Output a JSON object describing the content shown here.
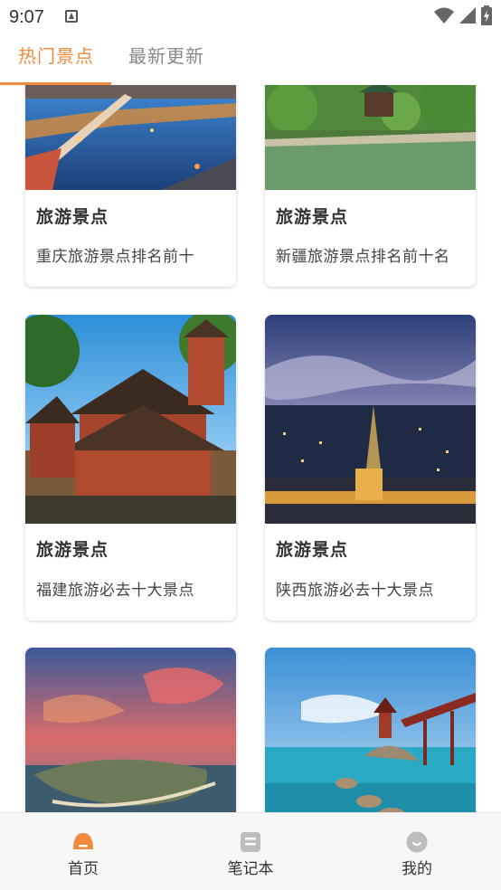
{
  "status": {
    "time": "9:07"
  },
  "tabs": [
    {
      "label": "热门景点",
      "active": true
    },
    {
      "label": "最新更新",
      "active": false
    }
  ],
  "cards": [
    {
      "title": "旅游景点",
      "subtitle": "重庆旅游景点排名前十"
    },
    {
      "title": "旅游景点",
      "subtitle": "新疆旅游景点排名前十名"
    },
    {
      "title": "旅游景点",
      "subtitle": "福建旅游必去十大景点"
    },
    {
      "title": "旅游景点",
      "subtitle": "陕西旅游必去十大景点"
    }
  ],
  "bottom_nav": [
    {
      "label": "首页",
      "icon": "home-icon",
      "active": true
    },
    {
      "label": "笔记本",
      "icon": "notebook-icon",
      "active": false
    },
    {
      "label": "我的",
      "icon": "profile-icon",
      "active": false
    }
  ],
  "colors": {
    "accent": "#f08a3c",
    "tab_inactive": "#888888",
    "nav_icon_inactive": "#bdbdbd"
  }
}
